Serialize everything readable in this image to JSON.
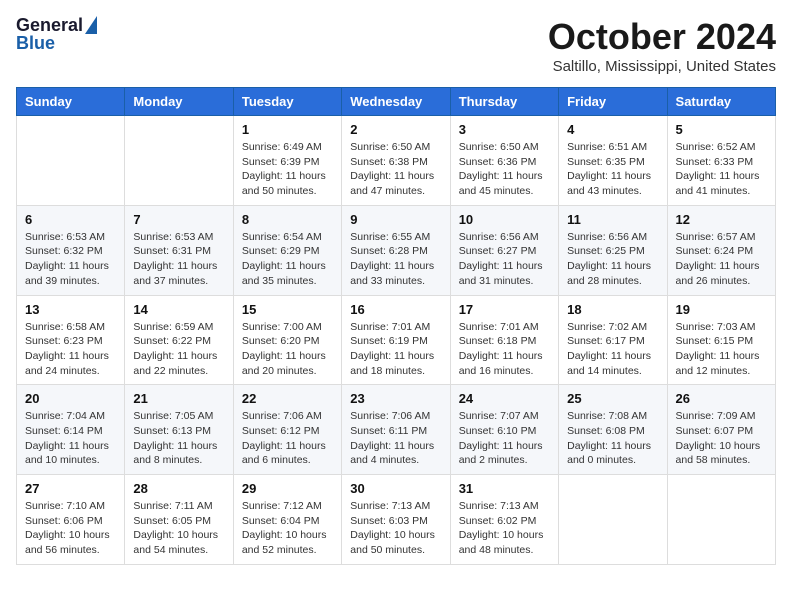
{
  "header": {
    "logo_general": "General",
    "logo_blue": "Blue",
    "month_title": "October 2024",
    "location": "Saltillo, Mississippi, United States"
  },
  "weekdays": [
    "Sunday",
    "Monday",
    "Tuesday",
    "Wednesday",
    "Thursday",
    "Friday",
    "Saturday"
  ],
  "weeks": [
    [
      {
        "day": "",
        "info": ""
      },
      {
        "day": "",
        "info": ""
      },
      {
        "day": "1",
        "info": "Sunrise: 6:49 AM\nSunset: 6:39 PM\nDaylight: 11 hours and 50 minutes."
      },
      {
        "day": "2",
        "info": "Sunrise: 6:50 AM\nSunset: 6:38 PM\nDaylight: 11 hours and 47 minutes."
      },
      {
        "day": "3",
        "info": "Sunrise: 6:50 AM\nSunset: 6:36 PM\nDaylight: 11 hours and 45 minutes."
      },
      {
        "day": "4",
        "info": "Sunrise: 6:51 AM\nSunset: 6:35 PM\nDaylight: 11 hours and 43 minutes."
      },
      {
        "day": "5",
        "info": "Sunrise: 6:52 AM\nSunset: 6:33 PM\nDaylight: 11 hours and 41 minutes."
      }
    ],
    [
      {
        "day": "6",
        "info": "Sunrise: 6:53 AM\nSunset: 6:32 PM\nDaylight: 11 hours and 39 minutes."
      },
      {
        "day": "7",
        "info": "Sunrise: 6:53 AM\nSunset: 6:31 PM\nDaylight: 11 hours and 37 minutes."
      },
      {
        "day": "8",
        "info": "Sunrise: 6:54 AM\nSunset: 6:29 PM\nDaylight: 11 hours and 35 minutes."
      },
      {
        "day": "9",
        "info": "Sunrise: 6:55 AM\nSunset: 6:28 PM\nDaylight: 11 hours and 33 minutes."
      },
      {
        "day": "10",
        "info": "Sunrise: 6:56 AM\nSunset: 6:27 PM\nDaylight: 11 hours and 31 minutes."
      },
      {
        "day": "11",
        "info": "Sunrise: 6:56 AM\nSunset: 6:25 PM\nDaylight: 11 hours and 28 minutes."
      },
      {
        "day": "12",
        "info": "Sunrise: 6:57 AM\nSunset: 6:24 PM\nDaylight: 11 hours and 26 minutes."
      }
    ],
    [
      {
        "day": "13",
        "info": "Sunrise: 6:58 AM\nSunset: 6:23 PM\nDaylight: 11 hours and 24 minutes."
      },
      {
        "day": "14",
        "info": "Sunrise: 6:59 AM\nSunset: 6:22 PM\nDaylight: 11 hours and 22 minutes."
      },
      {
        "day": "15",
        "info": "Sunrise: 7:00 AM\nSunset: 6:20 PM\nDaylight: 11 hours and 20 minutes."
      },
      {
        "day": "16",
        "info": "Sunrise: 7:01 AM\nSunset: 6:19 PM\nDaylight: 11 hours and 18 minutes."
      },
      {
        "day": "17",
        "info": "Sunrise: 7:01 AM\nSunset: 6:18 PM\nDaylight: 11 hours and 16 minutes."
      },
      {
        "day": "18",
        "info": "Sunrise: 7:02 AM\nSunset: 6:17 PM\nDaylight: 11 hours and 14 minutes."
      },
      {
        "day": "19",
        "info": "Sunrise: 7:03 AM\nSunset: 6:15 PM\nDaylight: 11 hours and 12 minutes."
      }
    ],
    [
      {
        "day": "20",
        "info": "Sunrise: 7:04 AM\nSunset: 6:14 PM\nDaylight: 11 hours and 10 minutes."
      },
      {
        "day": "21",
        "info": "Sunrise: 7:05 AM\nSunset: 6:13 PM\nDaylight: 11 hours and 8 minutes."
      },
      {
        "day": "22",
        "info": "Sunrise: 7:06 AM\nSunset: 6:12 PM\nDaylight: 11 hours and 6 minutes."
      },
      {
        "day": "23",
        "info": "Sunrise: 7:06 AM\nSunset: 6:11 PM\nDaylight: 11 hours and 4 minutes."
      },
      {
        "day": "24",
        "info": "Sunrise: 7:07 AM\nSunset: 6:10 PM\nDaylight: 11 hours and 2 minutes."
      },
      {
        "day": "25",
        "info": "Sunrise: 7:08 AM\nSunset: 6:08 PM\nDaylight: 11 hours and 0 minutes."
      },
      {
        "day": "26",
        "info": "Sunrise: 7:09 AM\nSunset: 6:07 PM\nDaylight: 10 hours and 58 minutes."
      }
    ],
    [
      {
        "day": "27",
        "info": "Sunrise: 7:10 AM\nSunset: 6:06 PM\nDaylight: 10 hours and 56 minutes."
      },
      {
        "day": "28",
        "info": "Sunrise: 7:11 AM\nSunset: 6:05 PM\nDaylight: 10 hours and 54 minutes."
      },
      {
        "day": "29",
        "info": "Sunrise: 7:12 AM\nSunset: 6:04 PM\nDaylight: 10 hours and 52 minutes."
      },
      {
        "day": "30",
        "info": "Sunrise: 7:13 AM\nSunset: 6:03 PM\nDaylight: 10 hours and 50 minutes."
      },
      {
        "day": "31",
        "info": "Sunrise: 7:13 AM\nSunset: 6:02 PM\nDaylight: 10 hours and 48 minutes."
      },
      {
        "day": "",
        "info": ""
      },
      {
        "day": "",
        "info": ""
      }
    ]
  ]
}
